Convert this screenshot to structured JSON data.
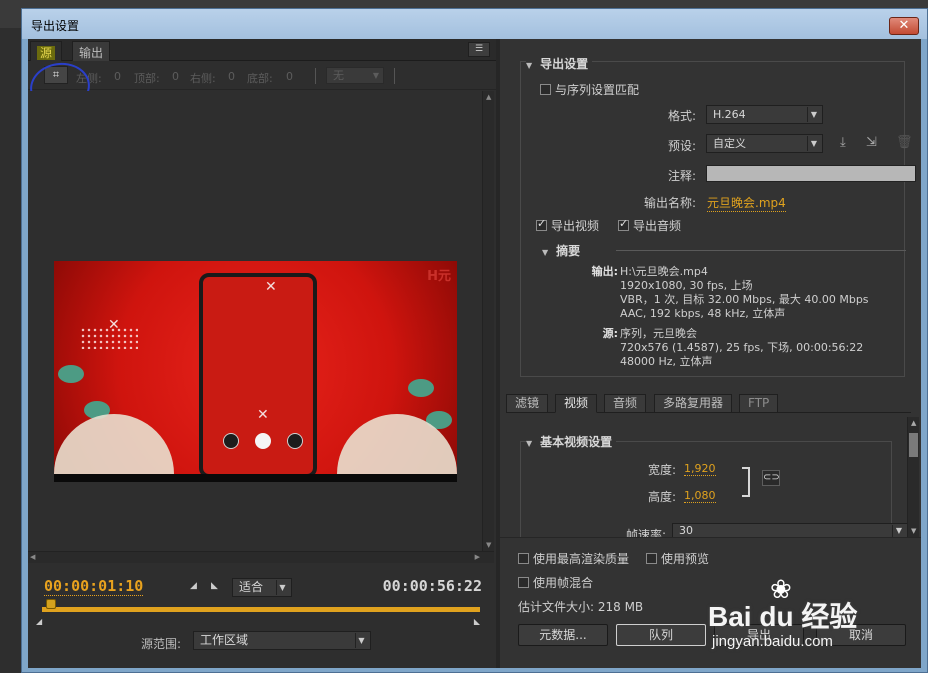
{
  "window": {
    "title": "导出设置",
    "close": "✕"
  },
  "source_panel": {
    "tabs": [
      "源",
      "输出"
    ],
    "menu_icon": "☰",
    "crop": {
      "icon": "crop-icon",
      "left_label": "左侧:",
      "left_value": "0",
      "top_label": "顶部:",
      "top_value": "0",
      "right_label": "右侧:",
      "right_value": "0",
      "bottom_label": "底部:",
      "bottom_value": "0",
      "ratio_value": "无"
    },
    "video_watermark": "H元"
  },
  "timeline": {
    "current": "00:00:01:10",
    "end": "00:00:56:22",
    "fit": "适合",
    "range_label": "源范围:",
    "range_value": "工作区域"
  },
  "export_settings": {
    "title": "导出设置",
    "match_sequence": "与序列设置匹配",
    "format_label": "格式:",
    "format_value": "H.264",
    "preset_label": "预设:",
    "preset_value": "自定义",
    "comment_label": "注释:",
    "output_name_label": "输出名称:",
    "output_name_value": "元旦晚会.mp4",
    "export_video": "导出视频",
    "export_audio": "导出音频",
    "summary": {
      "title": "摘要",
      "output_key": "输出:",
      "output_lines": [
        "H:\\元旦晚会.mp4",
        "1920x1080, 30 fps, 上场",
        "VBR，1 次, 目标 32.00 Mbps, 最大 40.00  Mbps",
        "AAC, 192 kbps, 48 kHz, 立体声"
      ],
      "source_key": "源:",
      "source_lines": [
        "序列，元旦晚会",
        "720x576 (1.4587), 25 fps, 下场, 00:00:56:22",
        "48000 Hz, 立体声"
      ]
    }
  },
  "right_tabs": [
    "滤镜",
    "视频",
    "音频",
    "多路复用器",
    "FTP"
  ],
  "basic_video": {
    "title": "基本视频设置",
    "width_label": "宽度:",
    "width_value": "1,920",
    "height_label": "高度:",
    "height_value": "1,080",
    "framerate_label": "帧速率:",
    "framerate_value": "30"
  },
  "bottom": {
    "max_render": "使用最高渲染质量",
    "use_preview": "使用预览",
    "frame_blend": "使用帧混合",
    "file_size": "估计文件大小: 218 MB",
    "metadata_btn": "元数据...",
    "queue_btn": "队列",
    "export_btn": "导出",
    "cancel_btn": "取消"
  },
  "watermark": {
    "brand": "Bai du 经验",
    "url": "jingyan.baidu.com"
  }
}
